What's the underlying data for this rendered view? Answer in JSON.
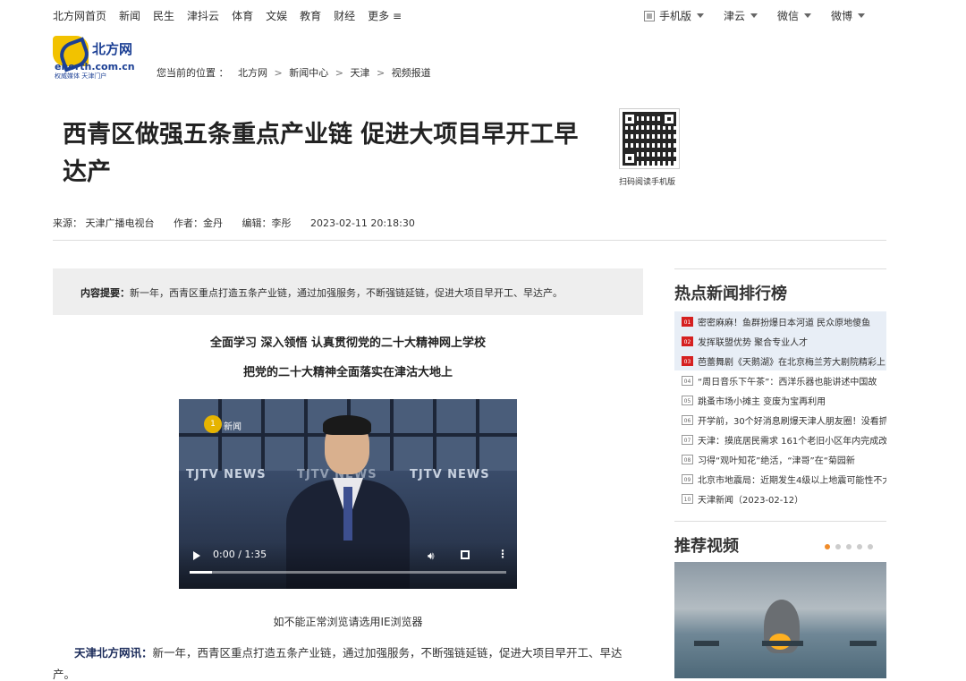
{
  "topnav": {
    "links": [
      "北方网首页",
      "新闻",
      "民生",
      "津抖云",
      "体育",
      "文娱",
      "教育",
      "财经",
      "更多 ≡"
    ],
    "right": [
      {
        "label": "手机版",
        "icon": "phone-icon"
      },
      {
        "label": "津云"
      },
      {
        "label": "微信"
      },
      {
        "label": "微博"
      }
    ]
  },
  "logo": {
    "cn": "北方网",
    "en": "enorth.com.cn",
    "slogan": "权威媒体 天津门户"
  },
  "breadcrumb": {
    "prefix": "您当前的位置 ：",
    "items": [
      "北方网",
      "新闻中心",
      "天津",
      "视频报道"
    ],
    "separator": ">"
  },
  "article": {
    "title": "西青区做强五条重点产业链 促进大项目早开工早达产",
    "qr_caption": "扫码阅读手机版",
    "meta": {
      "source": "来源： 天津广播电视台",
      "author": "作者：金丹",
      "editor": "编辑：李彤",
      "time": "2023-02-11 20:18:30"
    },
    "summary_label": "内容提要：",
    "summary_text": "新一年，西青区重点打造五条产业链，通过加强服务，不断强链延链，促进大项目早开工、早达产。",
    "subhead1": "全面学习 深入领悟 认真贯彻党的二十大精神网上学校",
    "subhead2": "把党的二十大精神全面落实在津沽大地上",
    "video": {
      "badge": "1",
      "badge_text": "新闻",
      "brand": "TJTV NEWS",
      "time": "0:00 / 1:35",
      "progress": 0.07
    },
    "ie_note": "如不能正常浏览请选用IE浏览器",
    "body_lead": "天津北方网讯：",
    "body_text": "新一年，西青区重点打造五条产业链，通过加强服务，不断强链延链，促进大项目早开工、早达产。"
  },
  "sidebar": {
    "hot_title": "热点新闻排行榜",
    "hot_items": [
      {
        "num": "01",
        "text": "密密麻麻！鱼群扮爆日本河道 民众原地傻鱼",
        "top": true
      },
      {
        "num": "02",
        "text": "发挥联盟优势 聚合专业人才",
        "top": true
      },
      {
        "num": "03",
        "text": "芭蕾舞剧《天鹅湖》在北京梅兰芳大剧院精彩上",
        "top": true
      },
      {
        "num": "04",
        "text": "“周日音乐下午茶”：西洋乐器也能讲述中国故",
        "top": false
      },
      {
        "num": "05",
        "text": "跳蚤市场小摊主 变废为宝再利用",
        "top": false
      },
      {
        "num": "06",
        "text": "开学前，30个好消息刷爆天津人朋友圈！没看抓",
        "top": false
      },
      {
        "num": "07",
        "text": "天津：摸底居民需求 161个老旧小区年内完成改",
        "top": false
      },
      {
        "num": "08",
        "text": "习得“观叶知花”绝活，“津哥”在“菊园新",
        "top": false
      },
      {
        "num": "09",
        "text": "北京市地震局：近期发生4级以上地震可能性不大",
        "top": false
      },
      {
        "num": "10",
        "text": "天津新闻（2023-02-12）",
        "top": false
      }
    ],
    "rec_title": "推荐视频",
    "rec_dots": 5,
    "rec_active": 0
  },
  "colors": {
    "accent_red": "#d52020",
    "logo_blue": "#1b3f94",
    "logo_yellow": "#f2c200",
    "dot_active": "#f08c2a"
  }
}
